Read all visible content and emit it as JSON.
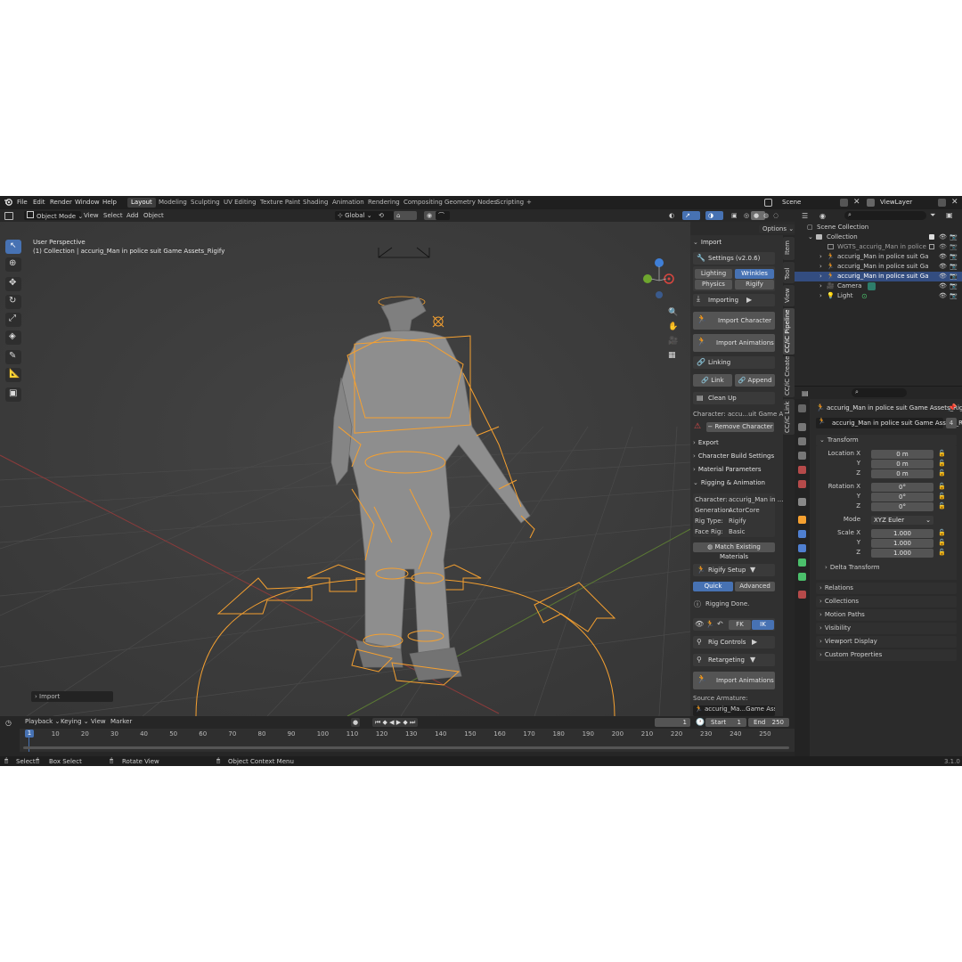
{
  "menu": {
    "items": [
      "File",
      "Edit",
      "Render",
      "Window",
      "Help"
    ],
    "workspaces": [
      "Layout",
      "Modeling",
      "Sculpting",
      "UV Editing",
      "Texture Paint",
      "Shading",
      "Animation",
      "Rendering",
      "Compositing",
      "Geometry Nodes",
      "Scripting"
    ],
    "active_workspace": "Layout",
    "add_tab": "+",
    "scene_label": "Scene",
    "viewlayer_label": "ViewLayer"
  },
  "viewport_header": {
    "mode": "Object Mode",
    "menus": [
      "View",
      "Select",
      "Add",
      "Object"
    ],
    "orientation": "Global",
    "options": "Options"
  },
  "viewport": {
    "perspective": "User Perspective",
    "collection_info": "(1) Collection | accurig_Man in police suit Game Assets_Rigify",
    "last_op": "Import"
  },
  "npanel": {
    "header": "Import",
    "settings": "Settings  (v2.0.6)",
    "tabs_row1": [
      "Lighting",
      "Wrinkles"
    ],
    "tabs_row2": [
      "Physics",
      "Rigify"
    ],
    "importing": "Importing",
    "import_character": "Import Character",
    "import_animations": "Import Animations",
    "linking": "Linking",
    "link": "Link",
    "append": "Append",
    "clean_up": "Clean Up",
    "character_line": "Character: accu...uit Game Asset",
    "remove_character": "Remove Character",
    "sections": [
      "Export",
      "Character Build Settings",
      "Material Parameters",
      "Rigging & Animation"
    ],
    "info": [
      {
        "label": "Character:",
        "value": "accurig_Man in ..."
      },
      {
        "label": "Generation:",
        "value": "ActorCore"
      },
      {
        "label": "Rig Type:",
        "value": "Rigify"
      },
      {
        "label": "Face Rig:",
        "value": "Basic"
      }
    ],
    "match_materials": "Match Existing Materials",
    "rigify_setup": "Rigify Setup",
    "quick": "Quick",
    "advanced": "Advanced",
    "rigging_done": "Rigging Done.",
    "fk": "FK",
    "ik": "IK",
    "rig_controls": "Rig Controls",
    "retargeting": "Retargeting",
    "import_animations2": "Import Animations",
    "source_armature": "Source Armature:",
    "source_value": "accurig_Ma...Game Assets",
    "vtabs": [
      "Item",
      "Tool",
      "View",
      "CC/iC Pipeline",
      "CC/iC Create",
      "CC/iC Link"
    ]
  },
  "outliner": {
    "scene_collection": "Scene Collection",
    "rows": [
      {
        "label": "Collection",
        "indent": 1,
        "selected": false
      },
      {
        "label": "WGTS_accurig_Man in police suit Ga",
        "indent": 2,
        "selected": false
      },
      {
        "label": "accurig_Man in police suit Game As",
        "indent": 2,
        "selected": false
      },
      {
        "label": "accurig_Man in police suit Game As",
        "indent": 2,
        "selected": false
      },
      {
        "label": "accurig_Man in police suit Game As",
        "indent": 2,
        "selected": true
      },
      {
        "label": "Camera",
        "indent": 2,
        "selected": false
      },
      {
        "label": "Light",
        "indent": 2,
        "selected": false
      }
    ]
  },
  "properties": {
    "object_path": "accurig_Man in police suit Game Assets_Rigi...",
    "object_name": "accurig_Man in police suit Game Assets_Ri...",
    "users": "4",
    "transform": "Transform",
    "location_label": "Location X",
    "rotation_label": "Rotation X",
    "scale_label": "Scale X",
    "y": "Y",
    "z": "Z",
    "location": [
      "0 m",
      "0 m",
      "0 m"
    ],
    "rotation": [
      "0°",
      "0°",
      "0°"
    ],
    "mode_label": "Mode",
    "mode": "XYZ Euler",
    "scale": [
      "1.000",
      "1.000",
      "1.000"
    ],
    "delta": "Delta Transform",
    "sections": [
      "Relations",
      "Collections",
      "Motion Paths",
      "Visibility",
      "Viewport Display",
      "Custom Properties"
    ]
  },
  "timeline": {
    "menus": [
      "Playback",
      "Keying",
      "View",
      "Marker"
    ],
    "current_frame": "1",
    "start_label": "Start",
    "start": "1",
    "end_label": "End",
    "end": "250",
    "ticks": [
      "1",
      "10",
      "20",
      "30",
      "40",
      "50",
      "60",
      "70",
      "80",
      "90",
      "100",
      "110",
      "120",
      "130",
      "140",
      "150",
      "160",
      "170",
      "180",
      "190",
      "200",
      "210",
      "220",
      "230",
      "240",
      "250"
    ]
  },
  "statusbar": {
    "items": [
      "Select",
      "Box Select",
      "Rotate View",
      "Object Context Menu"
    ],
    "version": "3.1.0"
  },
  "colors": {
    "accent": "#4772b3",
    "selection_orange": "#f5a030",
    "viewport_bg": "#3d3d3d"
  }
}
